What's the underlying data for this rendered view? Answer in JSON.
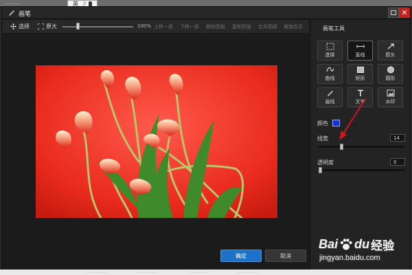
{
  "desktop": {
    "top_text": "…………",
    "ime_label": "英",
    "bottom_items": [
      "………………",
      "………………",
      "………………",
      "………………"
    ]
  },
  "dialog": {
    "title": "画笔",
    "close_glyph": "✕"
  },
  "toolbar": {
    "select_label": "选择",
    "original_label": "原大",
    "zoom_value": "100%",
    "zoom_level": 0.2,
    "actions": [
      "上移一层",
      "下移一层",
      "删除图层",
      "复制图层",
      "合并图层",
      "撤销合并"
    ]
  },
  "panel": {
    "title": "画笔工具",
    "tools": [
      {
        "label": "选择",
        "icon": "select-icon",
        "active": false
      },
      {
        "label": "直线",
        "icon": "line-icon",
        "active": true
      },
      {
        "label": "箭头",
        "icon": "arrow-icon",
        "active": false
      },
      {
        "label": "曲线",
        "icon": "curve-icon",
        "active": false
      },
      {
        "label": "矩形",
        "icon": "rectangle-icon",
        "active": false
      },
      {
        "label": "圆形",
        "icon": "circle-icon",
        "active": false
      },
      {
        "label": "画线",
        "icon": "brush-icon",
        "active": false
      },
      {
        "label": "文字",
        "icon": "text-icon",
        "active": false
      },
      {
        "label": "水印",
        "icon": "watermark-icon",
        "active": false
      }
    ],
    "color_label": "颜色",
    "color_value": "#1030e0",
    "line_width_label": "线宽",
    "line_width_value": "14",
    "line_width_level": 0.26,
    "opacity_label": "透明度",
    "opacity_value": "0",
    "opacity_level": 0.0
  },
  "buttons": {
    "ok": "确定",
    "cancel": "取消"
  },
  "watermark": {
    "bai": "Bai",
    "du": "du",
    "jingyan": "经验",
    "url": "jingyan.baidu.com"
  },
  "colors": {
    "accent": "#1d72c8",
    "close": "#c8201b",
    "annotation_arrow": "#d4161b"
  }
}
